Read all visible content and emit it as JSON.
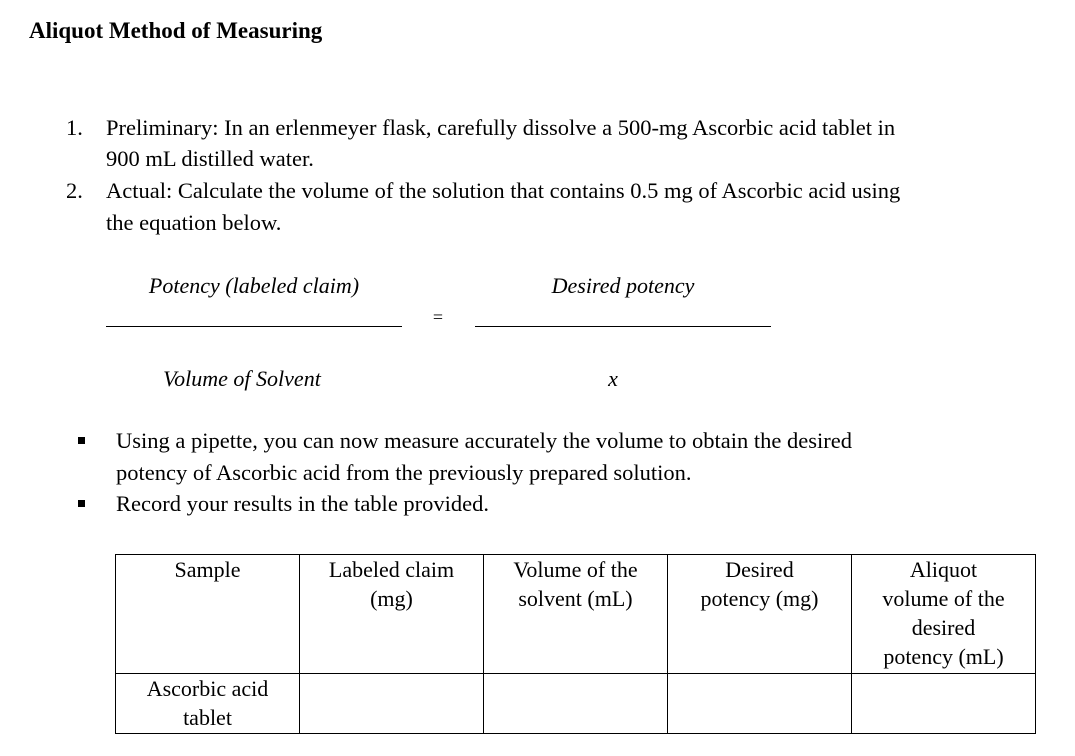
{
  "document": {
    "title": "Aliquot Method of Measuring",
    "steps": [
      {
        "number": "1.",
        "lines": [
          "Preliminary: In an erlenmeyer flask, carefully dissolve a 500-mg Ascorbic acid tablet in",
          "900 mL distilled water."
        ]
      },
      {
        "number": "2.",
        "lines": [
          "Actual: Calculate the volume of the solution that contains 0.5 mg of Ascorbic acid using",
          "the equation below."
        ]
      }
    ],
    "equation": {
      "left_numerator": "Potency (labeled claim)",
      "left_denominator": "Volume of Solvent",
      "equals": "=",
      "right_numerator": "Desired potency",
      "right_denominator": "x"
    },
    "bullets": [
      {
        "lines": [
          "Using a pipette, you can now measure accurately the volume to obtain the desired",
          "potency of Ascorbic acid from the previously prepared solution."
        ]
      },
      {
        "lines": [
          "Record your results in the table provided."
        ]
      }
    ],
    "table": {
      "headers": [
        [
          "Sample"
        ],
        [
          "Labeled claim",
          "(mg)"
        ],
        [
          "Volume of the",
          "solvent (mL)"
        ],
        [
          "Desired",
          "potency (mg)"
        ],
        [
          "Aliquot",
          "volume of the",
          "desired",
          "potency (mL)"
        ]
      ],
      "rows": [
        {
          "cells": [
            [
              "Ascorbic acid",
              "tablet"
            ],
            [
              ""
            ],
            [
              ""
            ],
            [
              ""
            ],
            [
              ""
            ]
          ]
        }
      ]
    }
  }
}
